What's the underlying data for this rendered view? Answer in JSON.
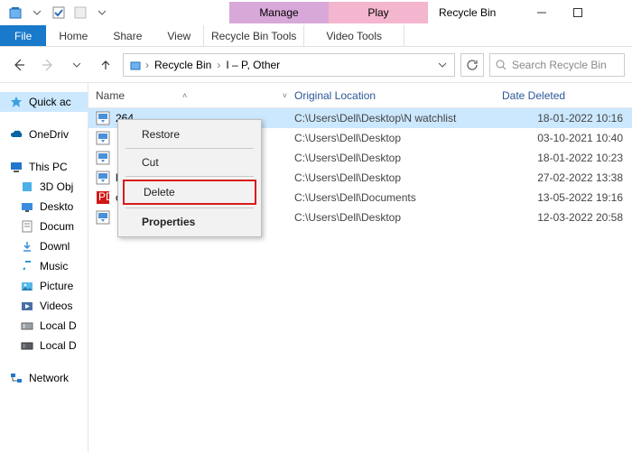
{
  "titlebar": {
    "ctx_manage": "Manage",
    "ctx_play": "Play",
    "title": "Recycle Bin"
  },
  "ribbon": {
    "file": "File",
    "home": "Home",
    "share": "Share",
    "view": "View",
    "recycle_tools": "Recycle Bin Tools",
    "video_tools": "Video Tools"
  },
  "nav": {
    "bread1": "Recycle Bin",
    "bread2": "I – P, Other",
    "search_placeholder": "Search Recycle Bin"
  },
  "sidebar": {
    "quick": "Quick ac",
    "onedrive": "OneDriv",
    "thispc": "This PC",
    "children": [
      {
        "label": "3D Obj"
      },
      {
        "label": "Deskto"
      },
      {
        "label": "Docum"
      },
      {
        "label": "Downl"
      },
      {
        "label": "Music"
      },
      {
        "label": "Picture"
      },
      {
        "label": "Videos"
      },
      {
        "label": "Local D"
      },
      {
        "label": "Local D"
      }
    ],
    "network": "Network"
  },
  "columns": {
    "name": "Name",
    "orig": "Original Location",
    "date": "Date Deleted"
  },
  "rows": [
    {
      "name": "264",
      "orig": "C:\\Users\\Dell\\Desktop\\N watchlist",
      "date": "18-01-2022 10:16",
      "type": "vid",
      "sel": true
    },
    {
      "name": "",
      "orig": "C:\\Users\\Dell\\Desktop",
      "date": "03-10-2021 10:40",
      "type": "vid"
    },
    {
      "name": "",
      "orig": "C:\\Users\\Dell\\Desktop",
      "date": "18-01-2022 10:23",
      "type": "vid"
    },
    {
      "name": "l H...",
      "orig": "C:\\Users\\Dell\\Desktop",
      "date": "27-02-2022 13:38",
      "type": "vid"
    },
    {
      "name": "orm...",
      "orig": "C:\\Users\\Dell\\Documents",
      "date": "13-05-2022 19:16",
      "type": "pdf"
    },
    {
      "name": "",
      "orig": "C:\\Users\\Dell\\Desktop",
      "date": "12-03-2022 20:58",
      "type": "vid"
    }
  ],
  "menu": {
    "restore": "Restore",
    "cut": "Cut",
    "delete": "Delete",
    "properties": "Properties"
  }
}
